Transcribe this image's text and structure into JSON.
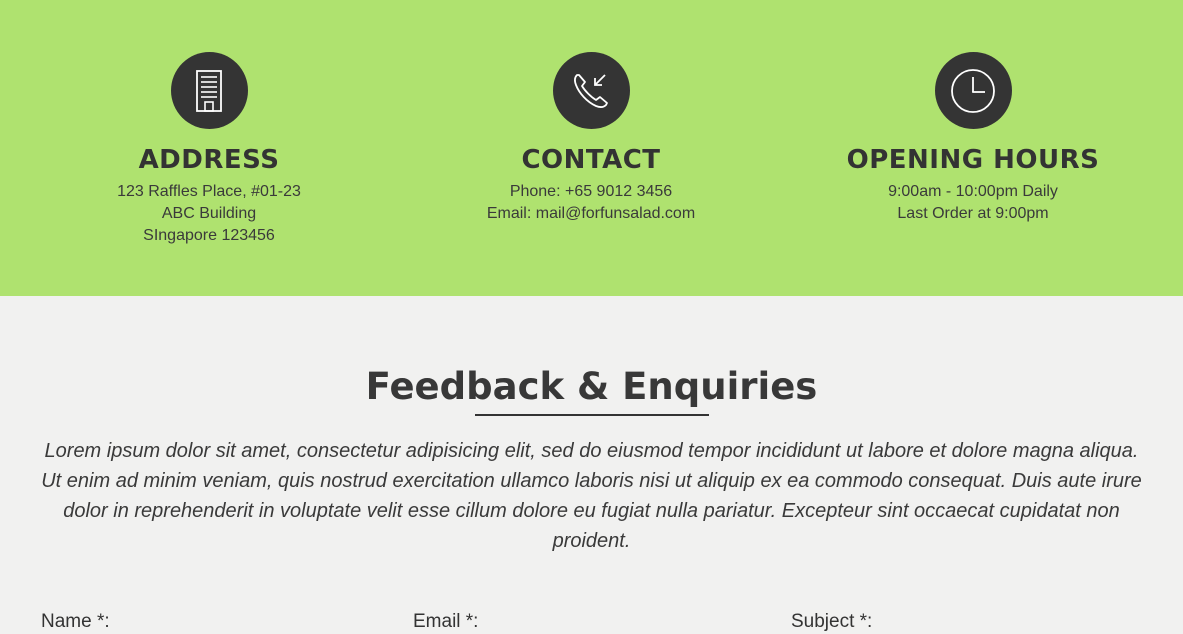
{
  "info": [
    {
      "icon": "building-icon",
      "title": "ADDRESS",
      "lines": [
        "123 Raffles Place, #01-23",
        "ABC Building",
        "SIngapore 123456"
      ]
    },
    {
      "icon": "phone-icon",
      "title": "CONTACT",
      "lines": [
        "Phone: +65 9012 3456",
        "Email: mail@forfunsalad.com"
      ]
    },
    {
      "icon": "clock-icon",
      "title": "OPENING HOURS",
      "lines": [
        "9:00am - 10:00pm Daily",
        "Last Order at 9:00pm"
      ]
    }
  ],
  "feedback": {
    "title": "Feedback & Enquiries",
    "text": "Lorem ipsum dolor sit amet, consectetur adipisicing elit, sed do eiusmod tempor incididunt ut labore et dolore magna aliqua. Ut enim ad minim veniam, quis nostrud exercitation ullamco laboris nisi ut aliquip ex ea commodo consequat. Duis aute irure dolor in reprehenderit in voluptate velit esse cillum dolore eu fugiat nulla pariatur. Excepteur sint occaecat cupidatat non proident."
  },
  "form": {
    "name_label": "Name *:",
    "email_label": "Email *:",
    "subject_label": "Subject *:"
  },
  "colors": {
    "band": "#afe26f",
    "icon_bg": "#343434",
    "page_bg": "#f1f1f0",
    "text": "#333333"
  }
}
